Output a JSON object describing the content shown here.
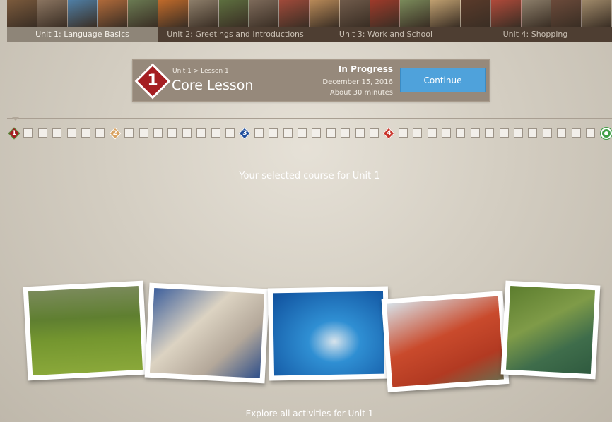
{
  "units": {
    "tabs": [
      {
        "label": "Unit 1: Language Basics",
        "active": true
      },
      {
        "label": "Unit 2: Greetings and Introductions",
        "active": false
      },
      {
        "label": "Unit 3: Work and School",
        "active": false
      },
      {
        "label": "Unit 4: Shopping",
        "active": false
      }
    ],
    "thumbnail_colors": [
      "#7b5a3c",
      "#8a7460",
      "#4f7fa6",
      "#b06a3a",
      "#6a7a52",
      "#c06a2a",
      "#8d7e6a",
      "#5d6f3f",
      "#7d6a5a",
      "#a04a3a",
      "#b98a58",
      "#6f5a4a",
      "#9e3a2a",
      "#7a8a5a",
      "#c0a070",
      "#5a3a2a",
      "#b04a3a",
      "#8c7e6a",
      "#6b4a3a",
      "#a08a6a"
    ]
  },
  "lesson": {
    "number": "1",
    "breadcrumb": "Unit 1 > Lesson 1",
    "title": "Core Lesson",
    "status": "In Progress",
    "date": "December 15, 2016",
    "duration": "About 30 minutes",
    "continue_label": "Continue",
    "accent_color": "#a51e22",
    "button_color": "#4fa2db"
  },
  "track": {
    "milestones": [
      {
        "label": "1",
        "color": "#a51e22",
        "border": "#4a9d3f"
      },
      {
        "label": "2",
        "color": "#d9a362",
        "border": "#ffffff"
      },
      {
        "label": "3",
        "color": "#1e4d9c",
        "border": "#ffffff"
      },
      {
        "label": "4",
        "color": "#c9352b",
        "border": "#ffffff"
      }
    ],
    "boxes_between": [
      6,
      8,
      9,
      14
    ],
    "end_icon": "completion-circle-icon"
  },
  "labels": {
    "selected_course": "Your selected course for Unit 1",
    "explore": "Explore all activities for Unit 1"
  },
  "photos": [
    {
      "icon": "photo-girl-in-red-sweater"
    },
    {
      "icon": "photo-students-with-newspapers"
    },
    {
      "icon": "photo-diver-and-grouper"
    },
    {
      "icon": "photo-friends-in-red-shirts"
    },
    {
      "icon": "photo-woman-with-green-mug"
    }
  ]
}
